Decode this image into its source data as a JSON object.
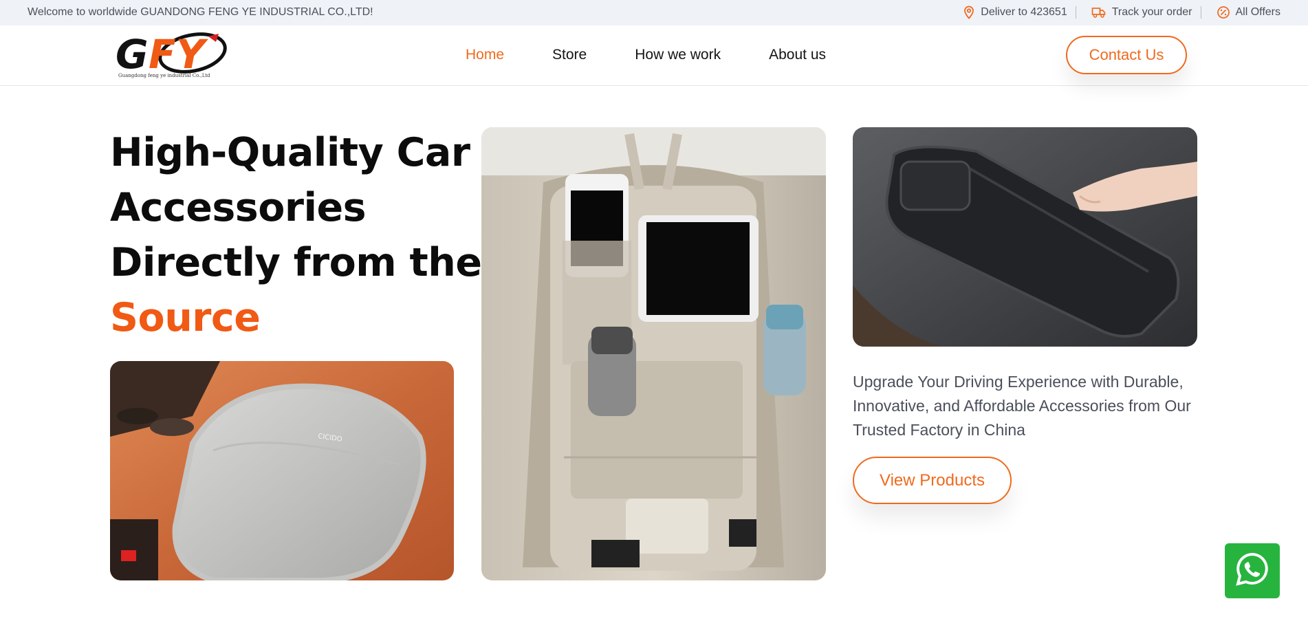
{
  "topbar": {
    "welcome": "Welcome to worldwide GUANDONG FENG YE INDUSTRIAL CO.,LTD!",
    "deliver": "Deliver to 423651",
    "track": "Track your order",
    "offers": "All Offers"
  },
  "logo": {
    "text": "GFY",
    "tagline": "Guangdong feng ye industrial Co.,Ltd"
  },
  "nav": {
    "items": [
      {
        "label": "Home",
        "active": true
      },
      {
        "label": "Store",
        "active": false
      },
      {
        "label": "How we work",
        "active": false
      },
      {
        "label": "About us",
        "active": false
      }
    ],
    "contact_label": "Contact Us"
  },
  "hero": {
    "line1": "High-Quality Car",
    "line2": "Accessories",
    "line3": "Directly from the",
    "highlight": "Source",
    "subtitle": "Upgrade Your Driving Experience with Durable, Innovative, and Affordable Accessories from Our Trusted Factory in China",
    "cta_label": "View Products",
    "armrest_brand": "CICIDO"
  },
  "colors": {
    "accent": "#ef6a1d",
    "highlight": "#f05a14",
    "topbar_bg": "#eff2f7",
    "whatsapp": "#27b43e"
  },
  "icons": [
    "location-pin-icon",
    "truck-icon",
    "discount-icon",
    "whatsapp-icon"
  ]
}
